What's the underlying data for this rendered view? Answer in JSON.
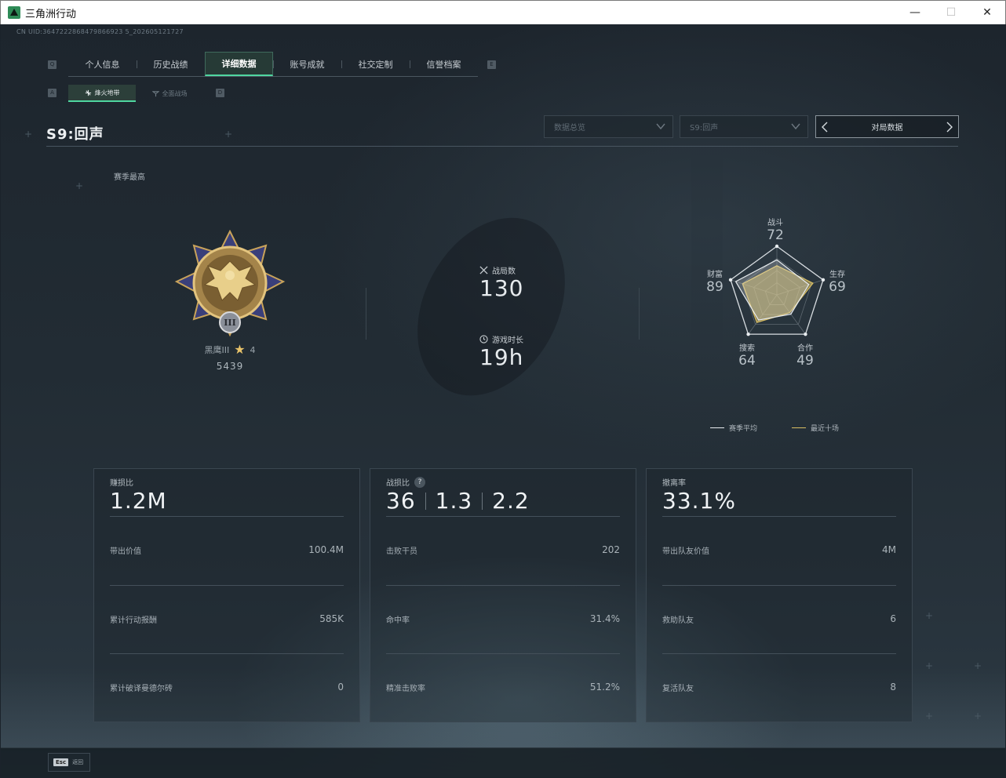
{
  "window": {
    "title": "三角洲行动",
    "minimize": "—",
    "maximize": "☐",
    "close": "✕"
  },
  "uid": "CN UID:3647222868479866923 5_202605121727",
  "keyhints": {
    "prev_tab": "Q",
    "next_tab": "E",
    "prev_sub": "A",
    "next_sub": "D"
  },
  "main_tabs": [
    {
      "label": "个人信息",
      "active": false
    },
    {
      "label": "历史战绩",
      "active": false
    },
    {
      "label": "详细数据",
      "active": true
    },
    {
      "label": "账号成就",
      "active": false
    },
    {
      "label": "社交定制",
      "active": false
    },
    {
      "label": "信誉档案",
      "active": false
    }
  ],
  "sub_tabs": [
    {
      "label": "烽火地带",
      "active": true
    },
    {
      "label": "全面战场",
      "active": false
    }
  ],
  "header": {
    "season_title": "S9:回声",
    "dropdown_data": "数据总览",
    "dropdown_season": "S9:回声",
    "match_data_label": "对局数据"
  },
  "season_best_label": "赛季最高",
  "rank": {
    "name": "黑鹰III",
    "stars": "4",
    "points": "5439"
  },
  "stats": {
    "matches_label": "战局数",
    "matches_value": "130",
    "playtime_label": "游戏时长",
    "playtime_value": "19h"
  },
  "radar": {
    "axes": [
      {
        "label": "战斗",
        "value": "72"
      },
      {
        "label": "生存",
        "value": "69"
      },
      {
        "label": "合作",
        "value": "49"
      },
      {
        "label": "搜索",
        "value": "64"
      },
      {
        "label": "财富",
        "value": "89"
      }
    ],
    "season_avg": [
      0.72,
      0.69,
      0.49,
      0.64,
      0.89
    ],
    "recent_ten": [
      0.6,
      0.78,
      0.45,
      0.7,
      0.74
    ],
    "legend_season_avg": "赛季平均",
    "legend_recent_ten": "最近十场",
    "color_season_avg": "#e8ecef",
    "color_recent_ten": "#d8be63"
  },
  "cards": [
    {
      "title": "赚损比",
      "big": [
        "1.2M"
      ],
      "help": false,
      "rows": [
        {
          "label": "带出价值",
          "value": "100.4M"
        },
        {
          "label": "累计行动报酬",
          "value": "585K"
        },
        {
          "label": "累计破译曼德尔砖",
          "value": "0"
        }
      ]
    },
    {
      "title": "战损比",
      "big": [
        "36",
        "1.3",
        "2.2"
      ],
      "help": true,
      "help_label": "?",
      "rows": [
        {
          "label": "击败干员",
          "value": "202"
        },
        {
          "label": "命中率",
          "value": "31.4%"
        },
        {
          "label": "精准击败率",
          "value": "51.2%"
        }
      ]
    },
    {
      "title": "撤离率",
      "big": [
        "33.1%"
      ],
      "help": false,
      "rows": [
        {
          "label": "带出队友价值",
          "value": "4M"
        },
        {
          "label": "救助队友",
          "value": "6"
        },
        {
          "label": "复活队友",
          "value": "8"
        }
      ]
    }
  ],
  "footer": {
    "esc_key": "Esc",
    "esc_label": "返回"
  },
  "accent_color": "#4fd6a0"
}
